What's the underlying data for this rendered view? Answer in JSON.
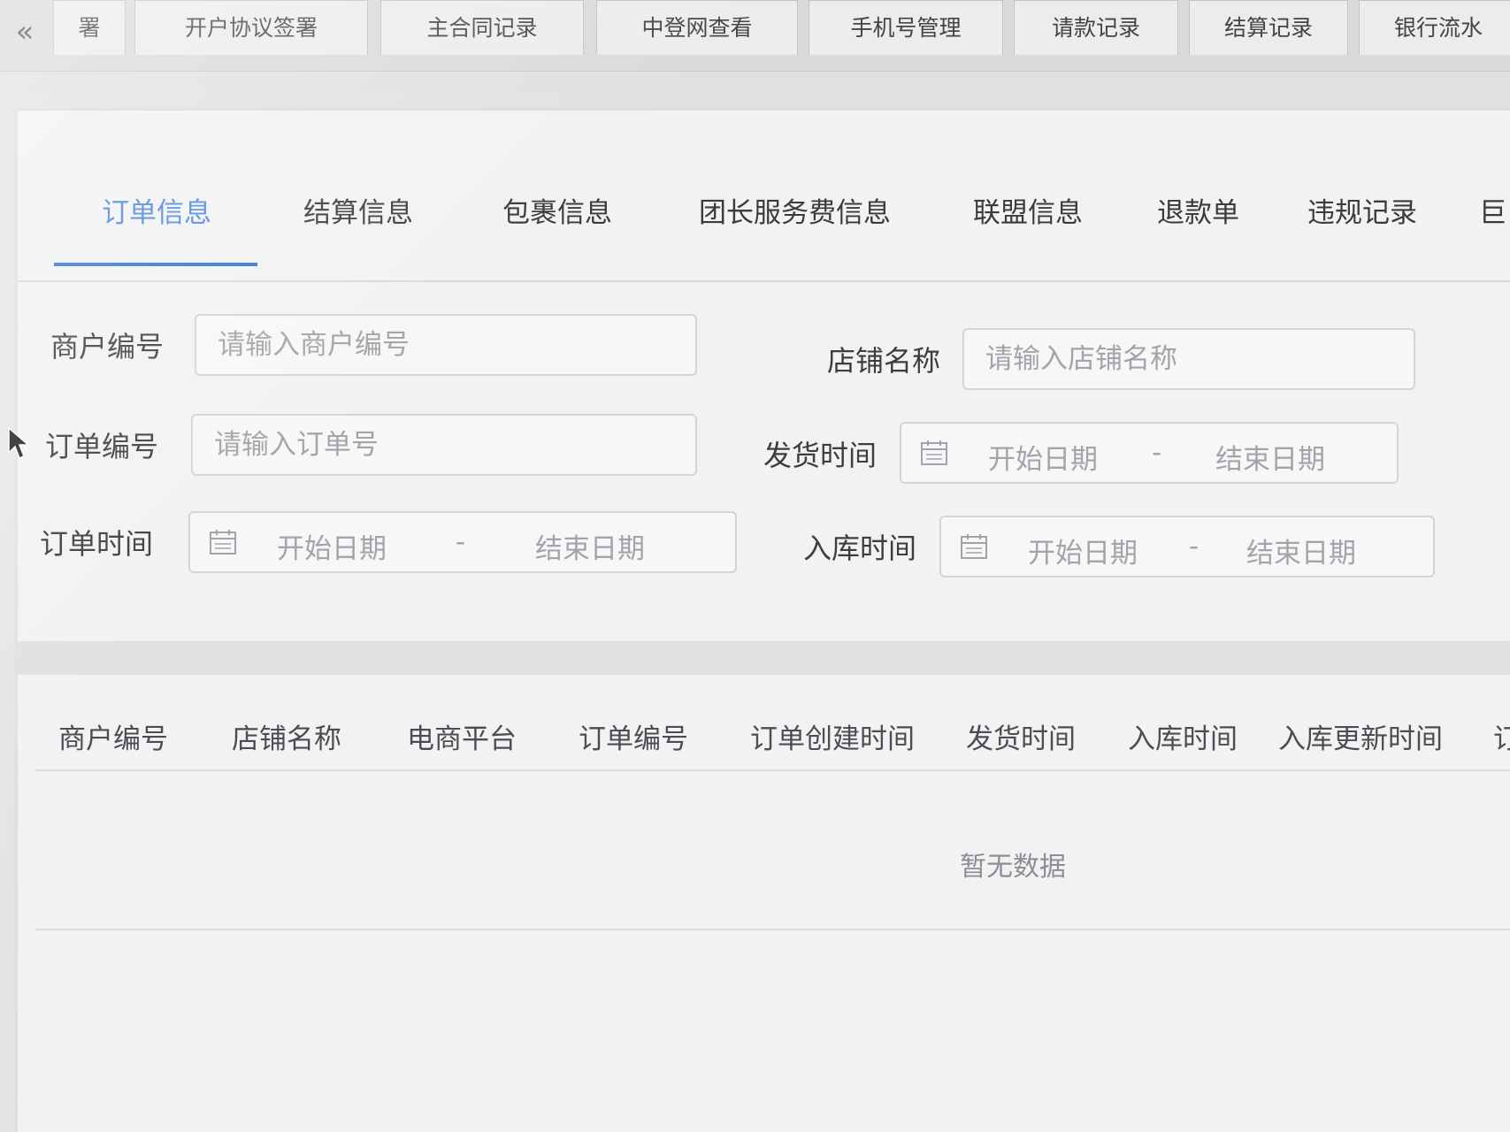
{
  "page_tabs": {
    "partial_first": "署",
    "items": [
      "开户协议签署",
      "主合同记录",
      "中登网查看",
      "手机号管理",
      "请款记录",
      "结算记录",
      "银行流水"
    ]
  },
  "section_tabs": {
    "active_index": 0,
    "items": [
      "订单信息",
      "结算信息",
      "包裹信息",
      "团长服务费信息",
      "联盟信息",
      "退款单",
      "违规记录",
      "巨"
    ]
  },
  "filters": {
    "merchant_no": {
      "label": "商户编号",
      "placeholder": "请输入商户编号",
      "value": ""
    },
    "store_name": {
      "label": "店铺名称",
      "placeholder": "请输入店铺名称",
      "value": ""
    },
    "order_no": {
      "label": "订单编号",
      "placeholder": "请输入订单号",
      "value": ""
    },
    "ship_time": {
      "label": "发货时间",
      "start": "开始日期",
      "sep": "-",
      "end": "结束日期"
    },
    "order_time": {
      "label": "订单时间",
      "start": "开始日期",
      "sep": "-",
      "end": "结束日期"
    },
    "stock_in_time": {
      "label": "入库时间",
      "start": "开始日期",
      "sep": "-",
      "end": "结束日期"
    }
  },
  "table": {
    "columns": [
      "商户编号",
      "店铺名称",
      "电商平台",
      "订单编号",
      "订单创建时间",
      "发货时间",
      "入库时间",
      "入库更新时间",
      "订"
    ],
    "rows": [],
    "empty_text": "暂无数据"
  },
  "colors": {
    "accent": "#2f74d0",
    "active_tab_text": "#4a86d8"
  }
}
